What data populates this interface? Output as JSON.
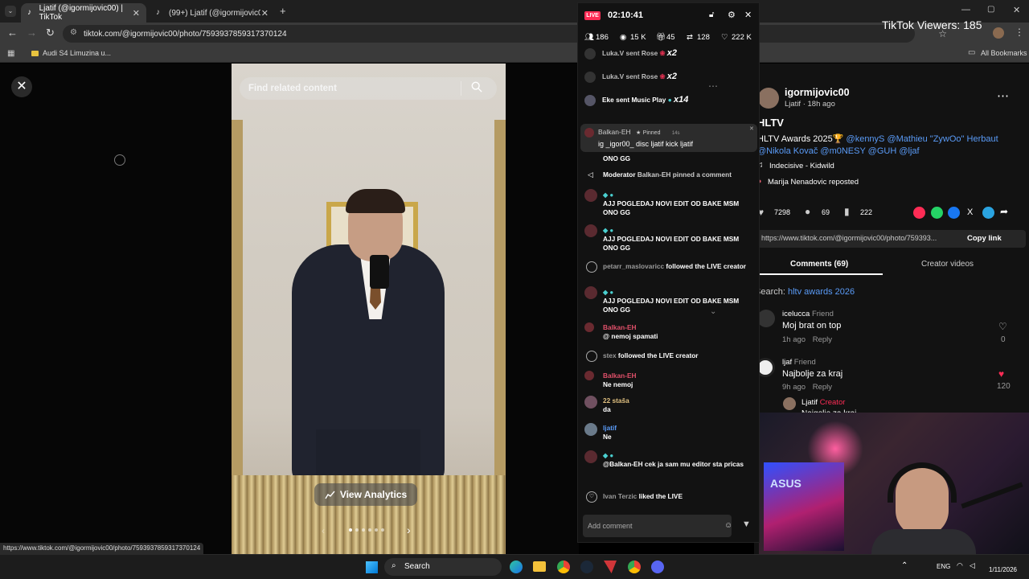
{
  "browser": {
    "tabs": [
      {
        "label": "Ljatif (@igormijovic00) | TikTok",
        "active": true
      },
      {
        "label": "(99+) Ljatif (@igormijovic00) | Ti",
        "active": false
      }
    ],
    "url": "tiktok.com/@igormijovic00/photo/7593937859317370124",
    "bookmark": "Audi S4 Limuzina u...",
    "all_bookmarks": "All Bookmarks",
    "status_url": "https://www.tiktok.com/@igormijovic00/photo/7593937859317370124"
  },
  "overlay": {
    "viewers": "TikTok Viewers: 185"
  },
  "viewer": {
    "search_placeholder": "Find related content",
    "view_analytics": "View Analytics"
  },
  "live": {
    "badge": "LIVE",
    "timer": "02:10:41",
    "stats": {
      "people": "186",
      "views": "15 K",
      "gifts": "45",
      "shares": "128",
      "likes": "222 K"
    },
    "events": [
      {
        "name": "Luka.V",
        "text": "sent Rose",
        "count": "x2"
      },
      {
        "name": "Luka.V",
        "text": "sent Rose",
        "count": "x2"
      },
      {
        "name": "Eke",
        "text": "sent Music Play",
        "count": "x14"
      }
    ],
    "pinned": {
      "user": "Balkan-EH",
      "tag": "Pinned",
      "time": "14s",
      "text": "ig _igor00_ disc ljatif kick ljatif"
    },
    "messages": [
      {
        "name": "",
        "text": "ONO GG"
      },
      {
        "name": "Moderator",
        "text": "Balkan-EH pinned a comment"
      },
      {
        "name": "",
        "text": "AJJ POGLEDAJ NOVI EDIT OD BAKE MSM ONO GG"
      },
      {
        "name": "",
        "text": "AJJ POGLEDAJ NOVI EDIT OD BAKE MSM ONO GG"
      },
      {
        "name": "petarr_maslovaricc",
        "text": "followed the LIVE creator"
      },
      {
        "name": "",
        "text": "AJJ POGLEDAJ NOVI EDIT OD BAKE MSM ONO GG"
      },
      {
        "name": "Balkan-EH",
        "text": "@ nemoj spamati"
      },
      {
        "name": "stex",
        "text": "followed the LIVE creator"
      },
      {
        "name": "Balkan-EH",
        "text": "Ne nemoj"
      },
      {
        "name": "22 staša",
        "text": "da"
      },
      {
        "name": "ljatif",
        "text": "Ne"
      },
      {
        "name": "",
        "text": "@Balkan-EH cek ja sam mu editor sta pricas"
      },
      {
        "name": "Ivan Terzic",
        "text": "liked the LIVE"
      }
    ],
    "add_comment": "Add comment"
  },
  "post": {
    "username": "igormijovic00",
    "meta": "Ljatif · 18h ago",
    "title": "HLTV",
    "caption_plain": "HLTV Awards 2025🏆",
    "caption_tags": "@kennyS @Mathieu \"ZywOo\" Herbaut @Nikola Kovač @m0NESY @GUH @ljaf",
    "music": "Indecisive - Kidwild",
    "repost": "Marija Nenadovic reposted",
    "likes": "7298",
    "comments": "69",
    "saves": "222",
    "link": "https://www.tiktok.com/@igormijovic00/photo/759393...",
    "copy_link": "Copy link",
    "tab_comments": "Comments (69)",
    "tab_creator": "Creator videos",
    "search_prefix": "Search:",
    "search_term": "hltv awards 2026",
    "comments_list": [
      {
        "user": "icelucca",
        "tag": "Friend",
        "text": "Moj brat on top",
        "time": "1h ago",
        "reply": "Reply",
        "likes": "0"
      },
      {
        "user": "ljaf",
        "tag": "Friend",
        "text": "Najbolje za kraj",
        "time": "9h ago",
        "reply": "Reply",
        "likes": "120"
      },
      {
        "user": "Ljatif",
        "tag": "Creator",
        "text": "Najgolje za kraj",
        "time": "",
        "reply": "",
        "likes": ""
      }
    ]
  },
  "taskbar": {
    "search": "Search",
    "lang": "ENG",
    "time": "",
    "date": "1/11/2026"
  },
  "colors": {
    "accent": "#fe2c55",
    "link": "#5a9bf7",
    "bg": "#121212"
  }
}
